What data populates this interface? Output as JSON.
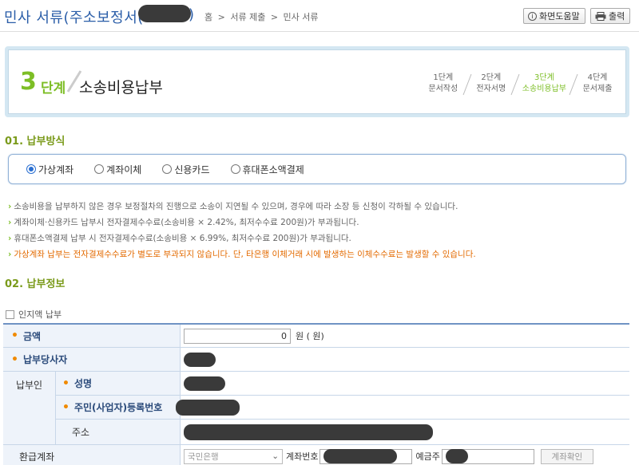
{
  "header": {
    "title": "민사 서류(주소보정서(",
    "title_close": ")",
    "breadcrumb": [
      "홈",
      ">",
      "서류 제출",
      ">",
      "민사 서류"
    ],
    "help_button": "화면도움말",
    "print_button": "출력"
  },
  "step": {
    "number": "3",
    "unit": "단계",
    "name": "소송비용납부",
    "steps": [
      {
        "line1": "1단계",
        "line2": "문서작성",
        "active": false
      },
      {
        "line1": "2단계",
        "line2": "전자서명",
        "active": false
      },
      {
        "line1": "3단계",
        "line2": "소송비용납부",
        "active": true
      },
      {
        "line1": "4단계",
        "line2": "문서제출",
        "active": false
      }
    ]
  },
  "section1": {
    "title": "01. 납부방식",
    "options": [
      {
        "label": "가상계좌",
        "checked": true
      },
      {
        "label": "계좌이체",
        "checked": false
      },
      {
        "label": "신용카드",
        "checked": false
      },
      {
        "label": "휴대폰소액결제",
        "checked": false
      }
    ],
    "notes": [
      "소송비용을 납부하지 않은 경우 보정절차의 진행으로 소송이 지연될 수 있으며, 경우에 따라 소장 등 신청이 각하될 수 있습니다.",
      "계좌이체·신용카드 납부시 전자결제수수료(소송비용 × 2.42%, 최저수수료 200원)가 부과됩니다.",
      "휴대폰소액결제 납부 시 전자결제수수료(소송비용 × 6.99%, 최저수수료 200원)가 부과됩니다.",
      "가상계좌 납부는 전자결제수수료가 별도로 부과되지 않습니다. 단, 타은행 이체거래 시에 발생하는 이체수수료는 발생할 수 있습니다."
    ]
  },
  "section2": {
    "title": "02. 납부정보",
    "stamp_label": "인지액 납부",
    "amount_label": "금액",
    "amount_value": "0",
    "amount_unit": "원 ( 원)",
    "party_label": "납부당사자",
    "payer_label": "납부인",
    "name_label": "성명",
    "id_label": "주민(사업자)등록번호",
    "address_label": "주소",
    "refund_label": "환급계좌",
    "bank_select": "국민은행",
    "account_label": "계좌번호",
    "holder_label": "예금주",
    "verify_button": "계좌확인"
  }
}
